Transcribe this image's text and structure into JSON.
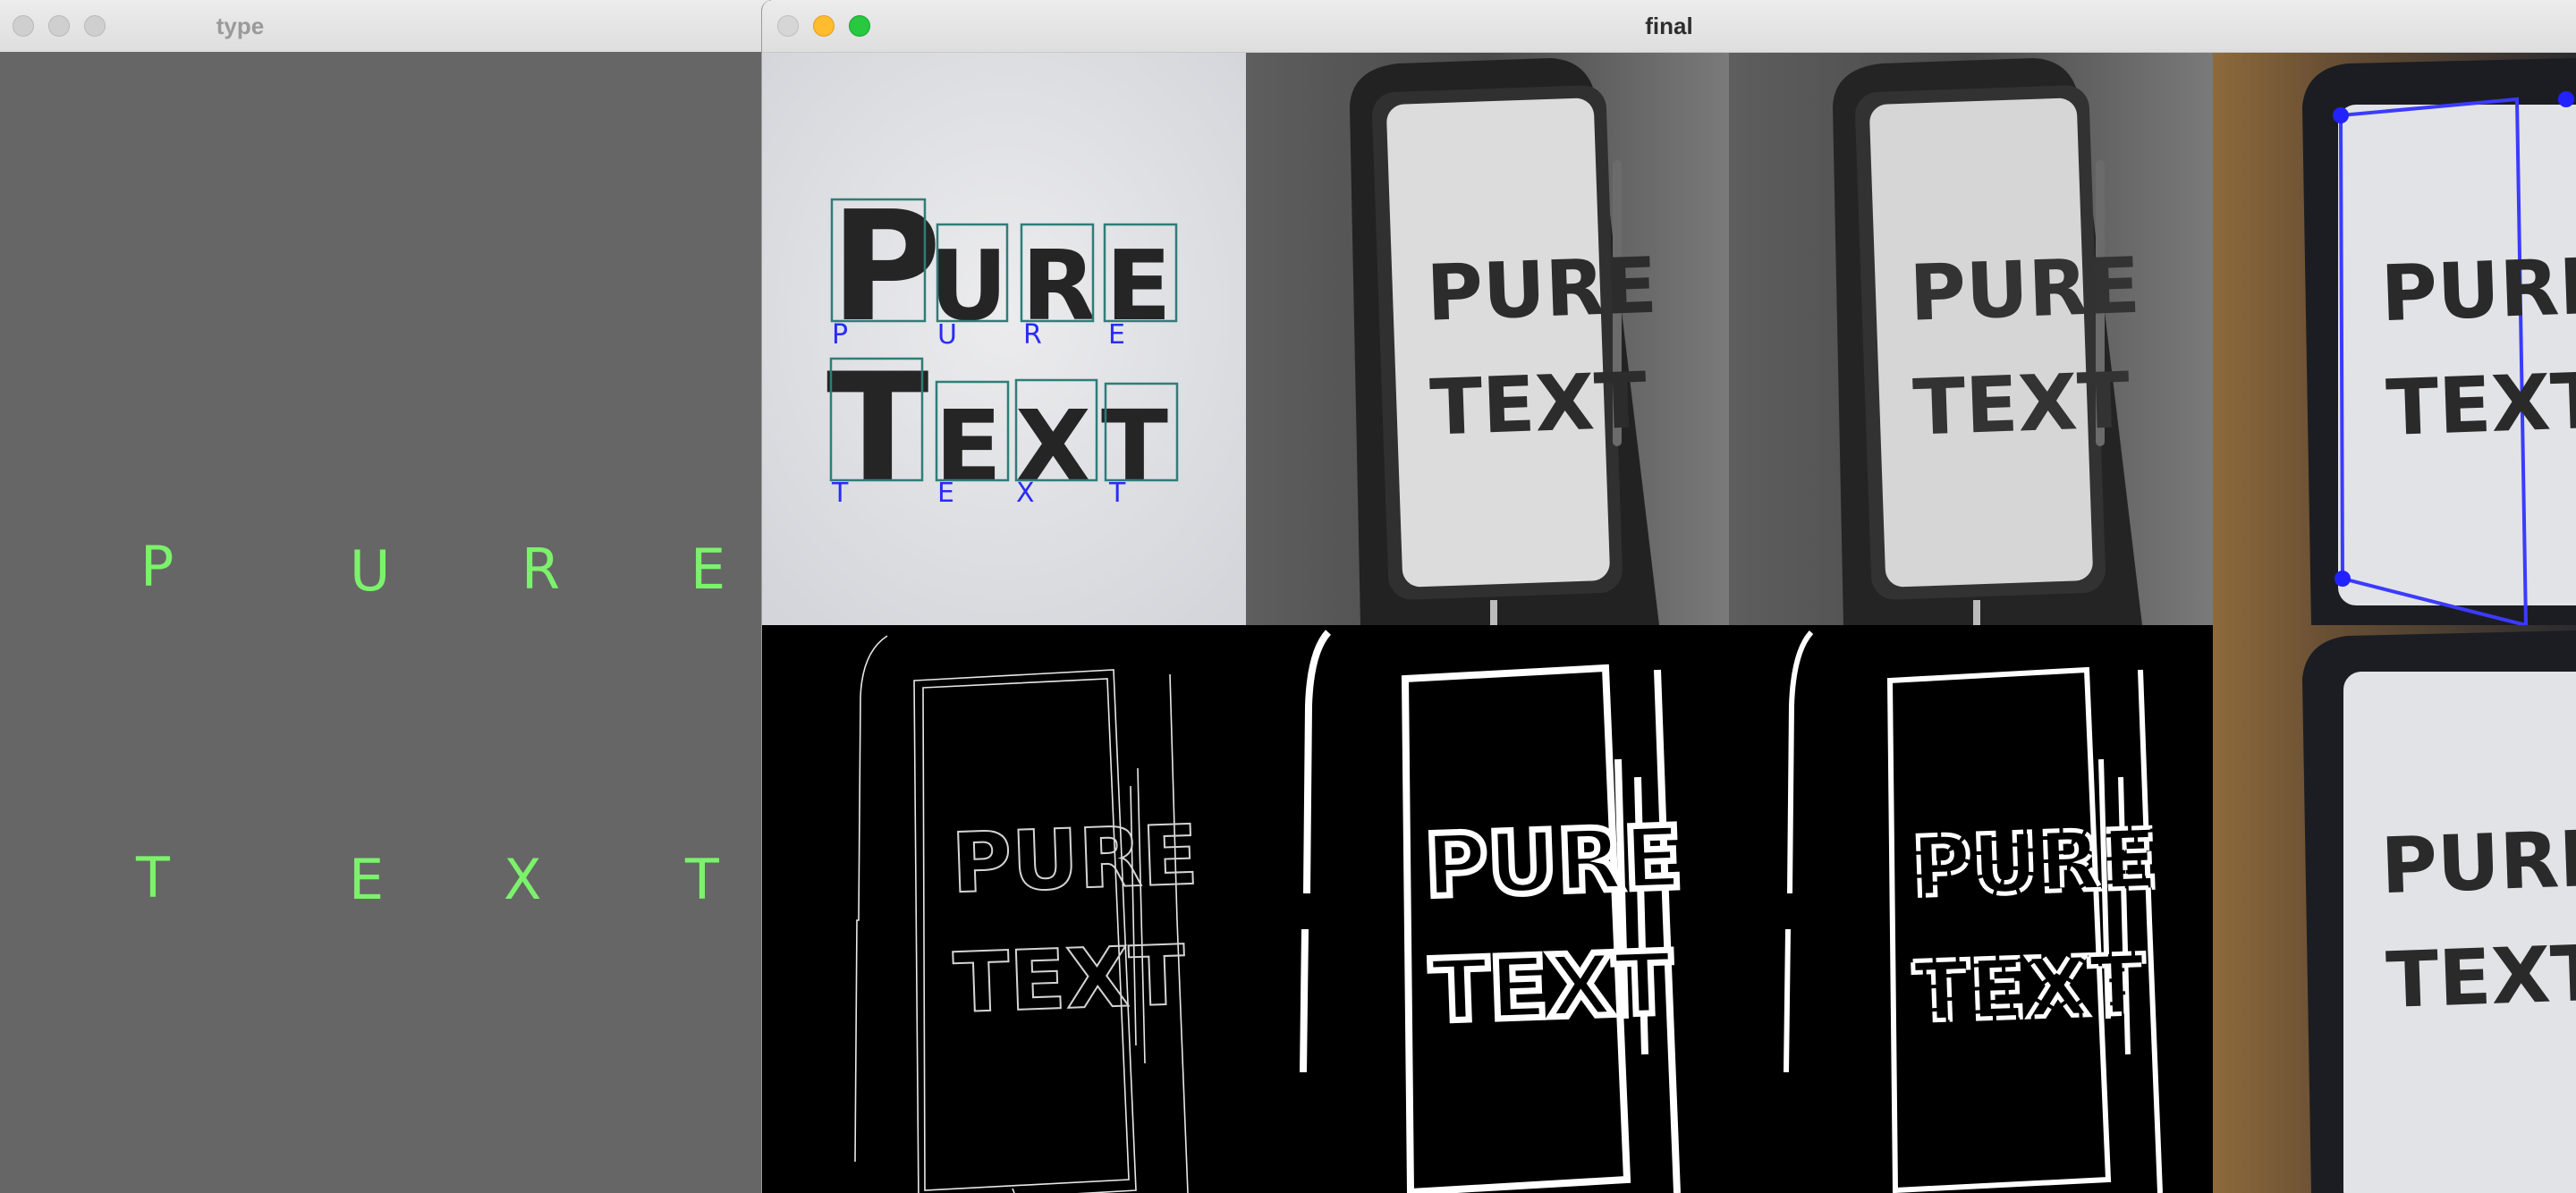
{
  "windows": {
    "type": {
      "title": "type",
      "letters_row1": [
        "P",
        "U",
        "R",
        "E"
      ],
      "letters_row2": [
        "T",
        "E",
        "X",
        "T"
      ],
      "text_color": "#7cf26c"
    },
    "final": {
      "title": "final",
      "panels": {
        "boxes": {
          "row1_char_labels": [
            "P",
            "U",
            "R",
            "E"
          ],
          "row2_char_labels": [
            "T",
            "E",
            "X",
            "T"
          ],
          "big_row1": [
            "P",
            "U",
            "R",
            "E"
          ],
          "big_row2": [
            "T",
            "E",
            "X",
            "T"
          ]
        },
        "phone_line1": "PURE",
        "phone_line2": "TEXT"
      },
      "colors": {
        "box_stroke": "#2f7d78",
        "label": "#2a2cf5",
        "contour": "#3b3bff"
      }
    }
  },
  "traffic_lights": {
    "close": "#ff5f57",
    "minimize": "#febc2e",
    "zoom": "#28c840",
    "inactive": "#cfcfcf"
  }
}
